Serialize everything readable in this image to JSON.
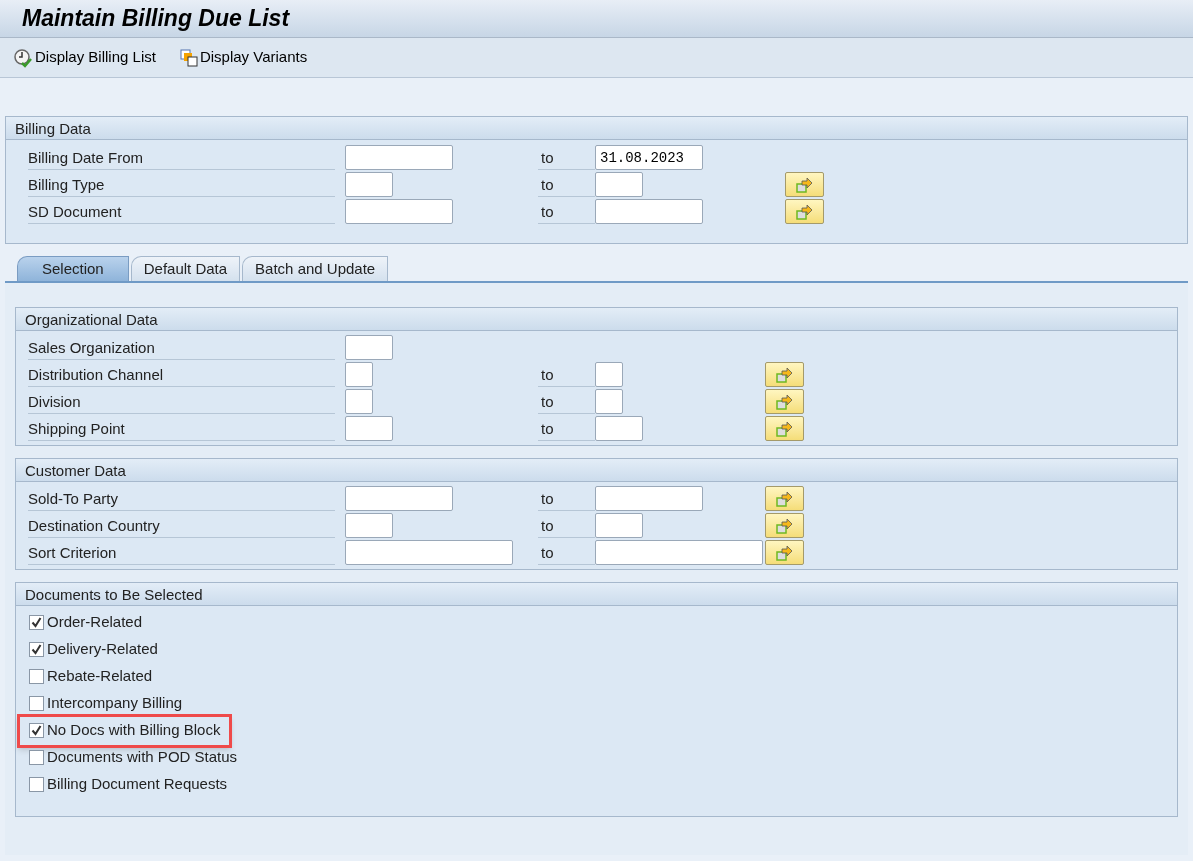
{
  "window": {
    "title": "Maintain Billing Due List"
  },
  "toolbar": [
    {
      "kind": "execute",
      "label": "Display Billing List"
    },
    {
      "kind": "variants",
      "label": "Display Variants"
    }
  ],
  "billing_data": {
    "title": "Billing Data",
    "rows": [
      {
        "kind": "long",
        "label": "Billing Date From",
        "value": "",
        "to_label": "to",
        "to_value": "31.08.2023",
        "multiple_selection": false
      },
      {
        "kind": "medium",
        "label": "Billing Type",
        "value": "",
        "to_label": "to",
        "to_value": "",
        "multiple_selection": true
      },
      {
        "kind": "long",
        "label": "SD Document",
        "value": "",
        "to_label": "to",
        "to_value": "",
        "multiple_selection": true
      }
    ]
  },
  "tabs": [
    {
      "label": "Selection",
      "selected": true
    },
    {
      "label": "Default Data",
      "selected": false
    },
    {
      "label": "Batch and Update",
      "selected": false
    }
  ],
  "groups": [
    {
      "title": "Organizational Data",
      "rows": [
        {
          "kind": "medium",
          "label": "Sales Organization",
          "value": "",
          "multiple_selection": false
        },
        {
          "kind": "short",
          "label": "Distribution Channel",
          "value": "",
          "to_label": "to",
          "to_value": "",
          "multiple_selection": true
        },
        {
          "kind": "short",
          "label": "Division",
          "value": "",
          "to_label": "to",
          "to_value": "",
          "multiple_selection": true
        },
        {
          "kind": "medium",
          "label": "Shipping Point",
          "value": "",
          "to_label": "to",
          "to_value": "",
          "multiple_selection": true
        }
      ]
    },
    {
      "title": "Customer Data",
      "rows": [
        {
          "kind": "long",
          "label": "Sold-To Party",
          "value": "",
          "to_label": "to",
          "to_value": "",
          "multiple_selection": true
        },
        {
          "kind": "medium",
          "label": "Destination Country",
          "value": "",
          "to_label": "to",
          "to_value": "",
          "multiple_selection": true
        },
        {
          "kind": "extra_long",
          "label": "Sort Criterion",
          "value": "",
          "to_label": "to",
          "to_value": "",
          "multiple_selection": true
        }
      ]
    }
  ],
  "documents": {
    "title": "Documents to Be Selected",
    "items": [
      {
        "label": "Order-Related",
        "checked": true,
        "highlighted": false
      },
      {
        "label": "Delivery-Related",
        "checked": true,
        "highlighted": false
      },
      {
        "label": "Rebate-Related",
        "checked": false,
        "highlighted": false
      },
      {
        "label": "Intercompany Billing",
        "checked": false,
        "highlighted": false
      },
      {
        "label": "No Docs with Billing Block",
        "checked": true,
        "highlighted": true
      },
      {
        "label": "Documents with POD Status",
        "checked": false,
        "highlighted": false
      },
      {
        "label": "Billing Document Requests",
        "checked": false,
        "highlighted": false
      }
    ]
  }
}
